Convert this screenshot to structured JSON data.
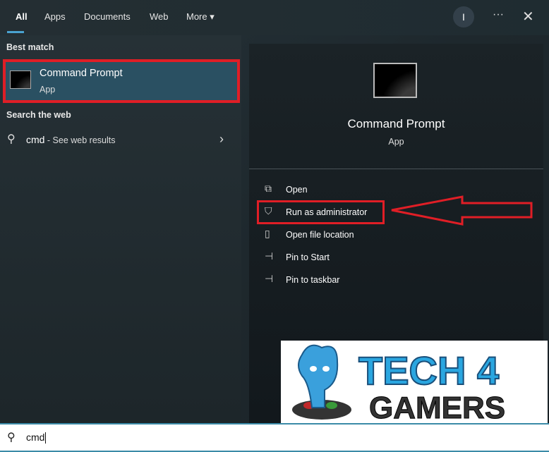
{
  "tabs": [
    {
      "label": "All",
      "active": true
    },
    {
      "label": "Apps"
    },
    {
      "label": "Documents"
    },
    {
      "label": "Web"
    },
    {
      "label": "More ▾"
    }
  ],
  "header": {
    "avatar_initial": "I",
    "more_options": "···",
    "close": "✕"
  },
  "left": {
    "best_match_heading": "Best match",
    "best_match": {
      "title": "Command Prompt",
      "type": "App"
    },
    "search_web_heading": "Search the web",
    "web_result": {
      "query": "cmd",
      "suffix": " - See web results"
    }
  },
  "right": {
    "title": "Command Prompt",
    "type": "App",
    "actions": [
      {
        "label": "Open",
        "icon": "open-icon"
      },
      {
        "label": "Run as administrator",
        "icon": "shield-icon"
      },
      {
        "label": "Open file location",
        "icon": "folder-icon"
      },
      {
        "label": "Pin to Start",
        "icon": "pin-icon"
      },
      {
        "label": "Pin to taskbar",
        "icon": "pin-icon"
      }
    ]
  },
  "logo": {
    "line1": "TECH 4",
    "line2": "GAMERS"
  },
  "search": {
    "value": "cmd"
  },
  "colors": {
    "accent": "#4aa3d0",
    "highlight": "#e01e26",
    "selected": "#2a5062"
  }
}
